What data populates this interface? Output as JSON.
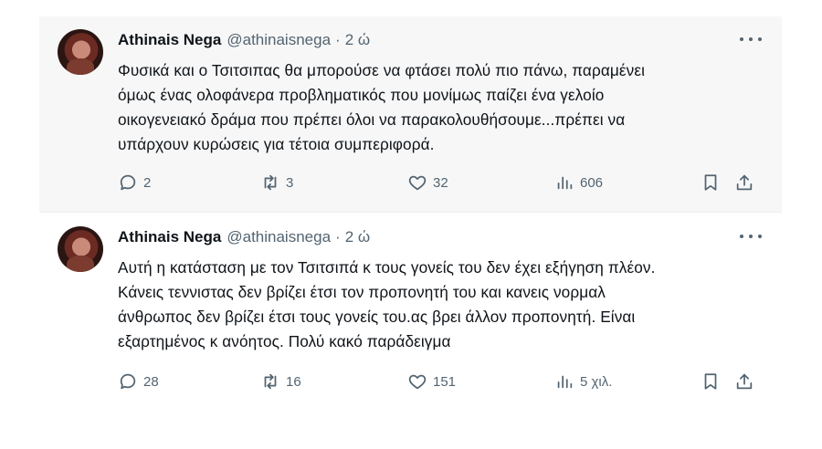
{
  "tweets": [
    {
      "name": "Athinais Nega",
      "handle": "@athinaisnega",
      "separator": "·",
      "time": "2 ώ",
      "text_lines": [
        "Φυσικά και ο Τσιτσιπας θα μπορούσε να φτάσει πολύ πιο πάνω, παραμένει",
        "όμως ένας ολοφάνερα προβληματικός που μονίμως παίζει ένα γελοίο",
        "οικογενειακό δράμα που πρέπει όλοι να παρακολουθήσουμε...πρέπει να",
        "υπάρχουν κυρώσεις για τέτοια συμπεριφορά."
      ],
      "replies": "2",
      "reposts": "3",
      "likes": "32",
      "views": "606",
      "icons": [
        "avatar",
        "more-icon",
        "reply-icon",
        "repost-icon",
        "like-icon",
        "views-icon",
        "bookmark-icon",
        "share-icon"
      ]
    },
    {
      "name": "Athinais Nega",
      "handle": "@athinaisnega",
      "separator": "·",
      "time": "2 ώ",
      "text_lines": [
        "Αυτή η κατάσταση με τον Τσιτσιπά κ τους γονείς του δεν έχει εξήγηση πλέον.",
        "Κάνεις τεννιστας δεν βρίζει έτσι τον προπονητή του και κανεις νορμαλ",
        "άνθρωπος δεν βρίζει έτσι τους γονείς του.ας βρει άλλον προπονητή. Είναι",
        "εξαρτημένος κ ανόητος. Πολύ κακό παράδειγμα"
      ],
      "replies": "28",
      "reposts": "16",
      "likes": "151",
      "views": "5 χιλ.",
      "icons": [
        "avatar",
        "more-icon",
        "reply-icon",
        "repost-icon",
        "like-icon",
        "views-icon",
        "bookmark-icon",
        "share-icon"
      ]
    }
  ],
  "colors": {
    "text": "#0f1419",
    "secondary": "#536471",
    "highlight_background": "#f7f7f7",
    "border": "#ebeef0"
  }
}
